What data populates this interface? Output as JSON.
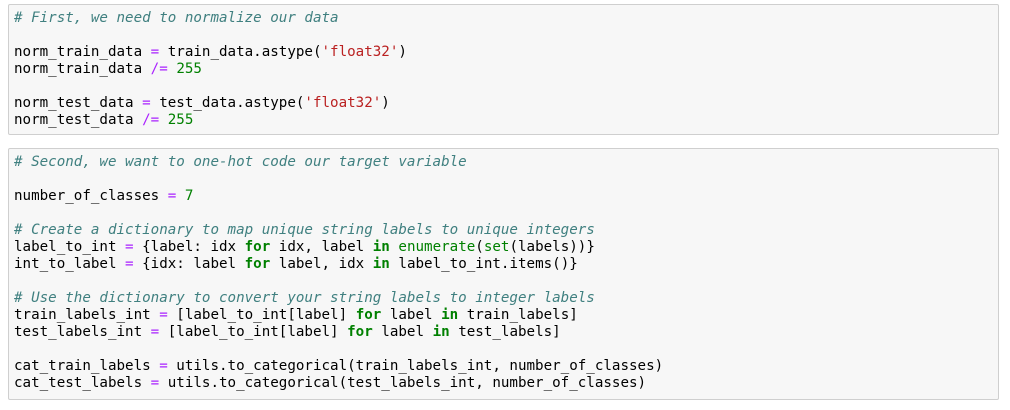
{
  "cells": [
    {
      "lines": [
        [
          {
            "t": "# First, we need to normalize our data",
            "k": "comment"
          }
        ],
        [],
        [
          {
            "t": "norm_train_data ",
            "k": "name"
          },
          {
            "t": "=",
            "k": "op"
          },
          {
            "t": " train_data.astype(",
            "k": "name"
          },
          {
            "t": "'float32'",
            "k": "str"
          },
          {
            "t": ")",
            "k": "name"
          }
        ],
        [
          {
            "t": "norm_train_data ",
            "k": "name"
          },
          {
            "t": "/=",
            "k": "op"
          },
          {
            "t": " ",
            "k": "name"
          },
          {
            "t": "255",
            "k": "num"
          }
        ],
        [],
        [
          {
            "t": "norm_test_data ",
            "k": "name"
          },
          {
            "t": "=",
            "k": "op"
          },
          {
            "t": " test_data.astype(",
            "k": "name"
          },
          {
            "t": "'float32'",
            "k": "str"
          },
          {
            "t": ")",
            "k": "name"
          }
        ],
        [
          {
            "t": "norm_test_data ",
            "k": "name"
          },
          {
            "t": "/=",
            "k": "op"
          },
          {
            "t": " ",
            "k": "name"
          },
          {
            "t": "255",
            "k": "num"
          }
        ]
      ]
    },
    {
      "lines": [
        [
          {
            "t": "# Second, we want to one-hot code our target variable",
            "k": "comment"
          }
        ],
        [],
        [
          {
            "t": "number_of_classes ",
            "k": "name"
          },
          {
            "t": "=",
            "k": "op"
          },
          {
            "t": " ",
            "k": "name"
          },
          {
            "t": "7",
            "k": "num"
          }
        ],
        [],
        [
          {
            "t": "# Create a dictionary to map unique string labels to unique integers",
            "k": "comment"
          }
        ],
        [
          {
            "t": "label_to_int ",
            "k": "name"
          },
          {
            "t": "=",
            "k": "op"
          },
          {
            "t": " {label: idx ",
            "k": "name"
          },
          {
            "t": "for",
            "k": "kw"
          },
          {
            "t": " idx, label ",
            "k": "name"
          },
          {
            "t": "in",
            "k": "kw"
          },
          {
            "t": " ",
            "k": "name"
          },
          {
            "t": "enumerate",
            "k": "builtin"
          },
          {
            "t": "(",
            "k": "name"
          },
          {
            "t": "set",
            "k": "builtin"
          },
          {
            "t": "(labels))}",
            "k": "name"
          }
        ],
        [
          {
            "t": "int_to_label ",
            "k": "name"
          },
          {
            "t": "=",
            "k": "op"
          },
          {
            "t": " {idx: label ",
            "k": "name"
          },
          {
            "t": "for",
            "k": "kw"
          },
          {
            "t": " label, idx ",
            "k": "name"
          },
          {
            "t": "in",
            "k": "kw"
          },
          {
            "t": " label_to_int.items()}",
            "k": "name"
          }
        ],
        [],
        [
          {
            "t": "# Use the dictionary to convert your string labels to integer labels",
            "k": "comment"
          }
        ],
        [
          {
            "t": "train_labels_int ",
            "k": "name"
          },
          {
            "t": "=",
            "k": "op"
          },
          {
            "t": " [label_to_int[label] ",
            "k": "name"
          },
          {
            "t": "for",
            "k": "kw"
          },
          {
            "t": " label ",
            "k": "name"
          },
          {
            "t": "in",
            "k": "kw"
          },
          {
            "t": " train_labels]",
            "k": "name"
          }
        ],
        [
          {
            "t": "test_labels_int ",
            "k": "name"
          },
          {
            "t": "=",
            "k": "op"
          },
          {
            "t": " [label_to_int[label] ",
            "k": "name"
          },
          {
            "t": "for",
            "k": "kw"
          },
          {
            "t": " label ",
            "k": "name"
          },
          {
            "t": "in",
            "k": "kw"
          },
          {
            "t": " test_labels]",
            "k": "name"
          }
        ],
        [],
        [
          {
            "t": "cat_train_labels ",
            "k": "name"
          },
          {
            "t": "=",
            "k": "op"
          },
          {
            "t": " utils.to_categorical(train_labels_int, number_of_classes)",
            "k": "name"
          }
        ],
        [
          {
            "t": "cat_test_labels ",
            "k": "name"
          },
          {
            "t": "=",
            "k": "op"
          },
          {
            "t": " utils.to_categorical(test_labels_int, number_of_classes)",
            "k": "name"
          }
        ]
      ]
    }
  ]
}
